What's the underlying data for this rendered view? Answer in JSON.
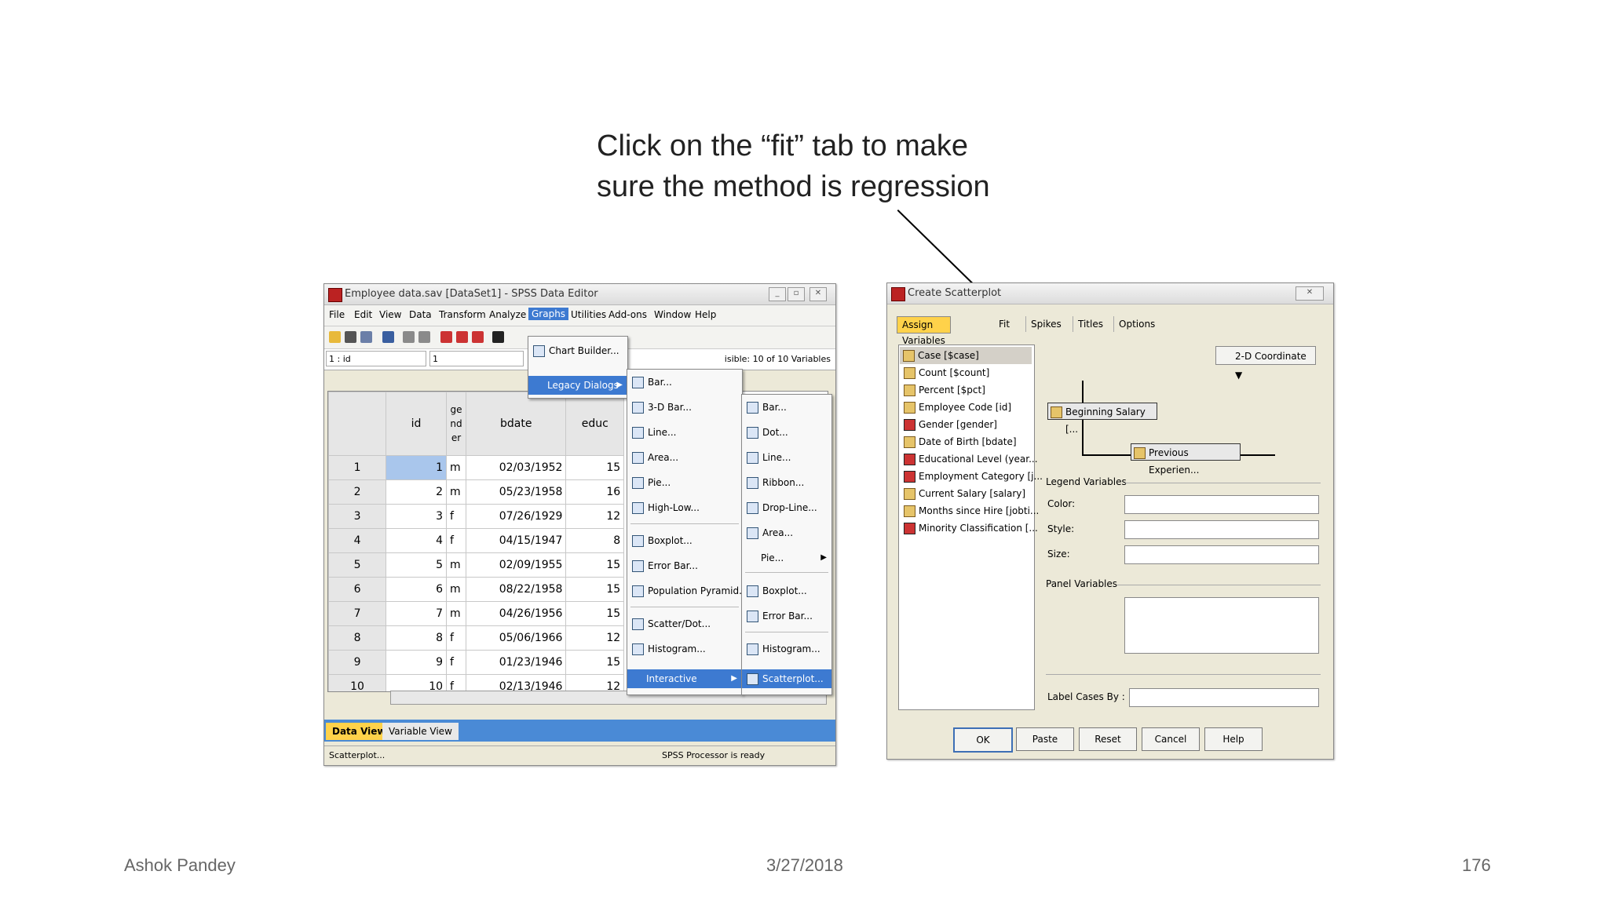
{
  "caption": {
    "line1": "Click on the “fit”    tab to make",
    "line2": "sure the method is regression"
  },
  "footer": {
    "author": "Ashok Pandey",
    "date": "3/27/2018",
    "page": "176"
  },
  "spss": {
    "title": "Employee data.sav [DataSet1] - SPSS Data Editor",
    "menu": [
      "File",
      "Edit",
      "View",
      "Data",
      "Transform",
      "Analyze",
      "Graphs",
      "Utilities",
      "Add-ons",
      "Window",
      "Help"
    ],
    "cell_ref": "1 : id",
    "cell_value": "1",
    "visible_vars": "isible: 10 of 10 Variables",
    "columns": [
      "id",
      "ge\nnd\ner",
      "bdate",
      "educ"
    ],
    "rows": [
      [
        "1",
        "1",
        "m",
        "02/03/1952",
        "15"
      ],
      [
        "2",
        "2",
        "m",
        "05/23/1958",
        "16"
      ],
      [
        "3",
        "3",
        "f",
        "07/26/1929",
        "12"
      ],
      [
        "4",
        "4",
        "f",
        "04/15/1947",
        "8"
      ],
      [
        "5",
        "5",
        "m",
        "02/09/1955",
        "15"
      ],
      [
        "6",
        "6",
        "m",
        "08/22/1958",
        "15"
      ],
      [
        "7",
        "7",
        "m",
        "04/26/1956",
        "15"
      ],
      [
        "8",
        "8",
        "f",
        "05/06/1966",
        "12"
      ],
      [
        "9",
        "9",
        "f",
        "01/23/1946",
        "15"
      ],
      [
        "10",
        "10",
        "f",
        "02/13/1946",
        "12"
      ]
    ],
    "tabs": [
      "Data View",
      "Variable View"
    ],
    "status_left": "Scatterplot...",
    "status_right": "SPSS  Processor is ready"
  },
  "graphs_menu": [
    "Chart Builder...",
    "Legacy Dialogs"
  ],
  "legacy_menu": [
    "Bar...",
    "3-D Bar...",
    "Line...",
    "Area...",
    "Pie...",
    "High-Low...",
    "Boxplot...",
    "Error Bar...",
    "Population Pyramid...",
    "Scatter/Dot...",
    "Histogram...",
    "Interactive"
  ],
  "interactive_menu": [
    "Bar...",
    "Dot...",
    "Line...",
    "Ribbon...",
    "Drop-Line...",
    "Area...",
    "Pie...",
    "Boxplot...",
    "Error Bar...",
    "Histogram...",
    "Scatterplot..."
  ],
  "dialog": {
    "title": "Create Scatterplot",
    "tabs": [
      "Assign Variables",
      "Fit",
      "Spikes",
      "Titles",
      "Options"
    ],
    "variables": [
      "Case [$case]",
      "Count [$count]",
      "Percent [$pct]",
      "Employee Code [id]",
      "Gender [gender]",
      "Date of Birth [bdate]",
      "Educational Level (year...",
      "Employment Category [j...",
      "Current Salary [salary]",
      "Months since Hire [jobti...",
      "Minority Classification [..."
    ],
    "coordinate": "2-D Coordinate",
    "y_var": "Beginning Salary [...",
    "x_var": "Previous Experien...",
    "legend_label": "Legend Variables",
    "color": "Color:",
    "style": "Style:",
    "size": "Size:",
    "panel_label": "Panel Variables",
    "label_cases": "Label Cases By :",
    "buttons": [
      "OK",
      "Paste",
      "Reset",
      "Cancel",
      "Help"
    ]
  }
}
